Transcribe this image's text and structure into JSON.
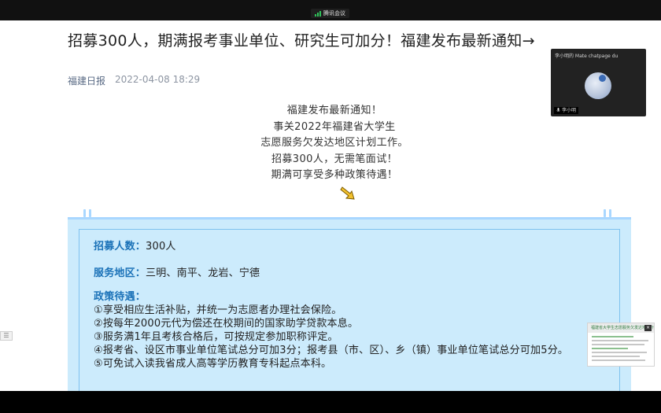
{
  "meeting": {
    "title": "腾讯会议"
  },
  "article": {
    "title": "招募300人，期满报考事业单位、研究生可加分！福建发布最新通知→",
    "source": "福建日报",
    "date": "2022-04-08 18:29",
    "intro": [
      "福建发布最新通知！",
      "事关2022年福建省大学生",
      "志愿服务欠发达地区计划工作。",
      "招募300人，无需笔面试！",
      "期满可享受多种政策待遇！"
    ],
    "recruit_label": "招募人数：",
    "recruit_value": "300人",
    "area_label": "服务地区：",
    "area_value": "三明、南平、龙岩、宁德",
    "policy_label": "政策待遇：",
    "policies": [
      "①享受相应生活补贴，并统一为志愿者办理社会保险。",
      "②按每年2000元代为偿还在校期间的国家助学贷款本息。",
      "③服务满1年且考核合格后，可按规定参加职称评定。",
      "④报考省、设区市事业单位笔试总分可加3分；报考县（市、区）、乡（镇）事业单位笔试总分可加5分。",
      "⑤可免试入读我省成人高等学历教育专科起点本科。"
    ]
  },
  "video": {
    "name": "李小明的 Mate chatpage du",
    "mic_label": "李小明"
  },
  "share": {
    "title": "福建省大学生志愿服务欠发达地区计划"
  },
  "icons": {
    "arrow": "down-right-arrow-icon",
    "signal": "signal-icon",
    "mic": "mic-icon"
  },
  "colors": {
    "accent_blue": "#1b72b8",
    "panel_blue": "#ccebfc"
  }
}
